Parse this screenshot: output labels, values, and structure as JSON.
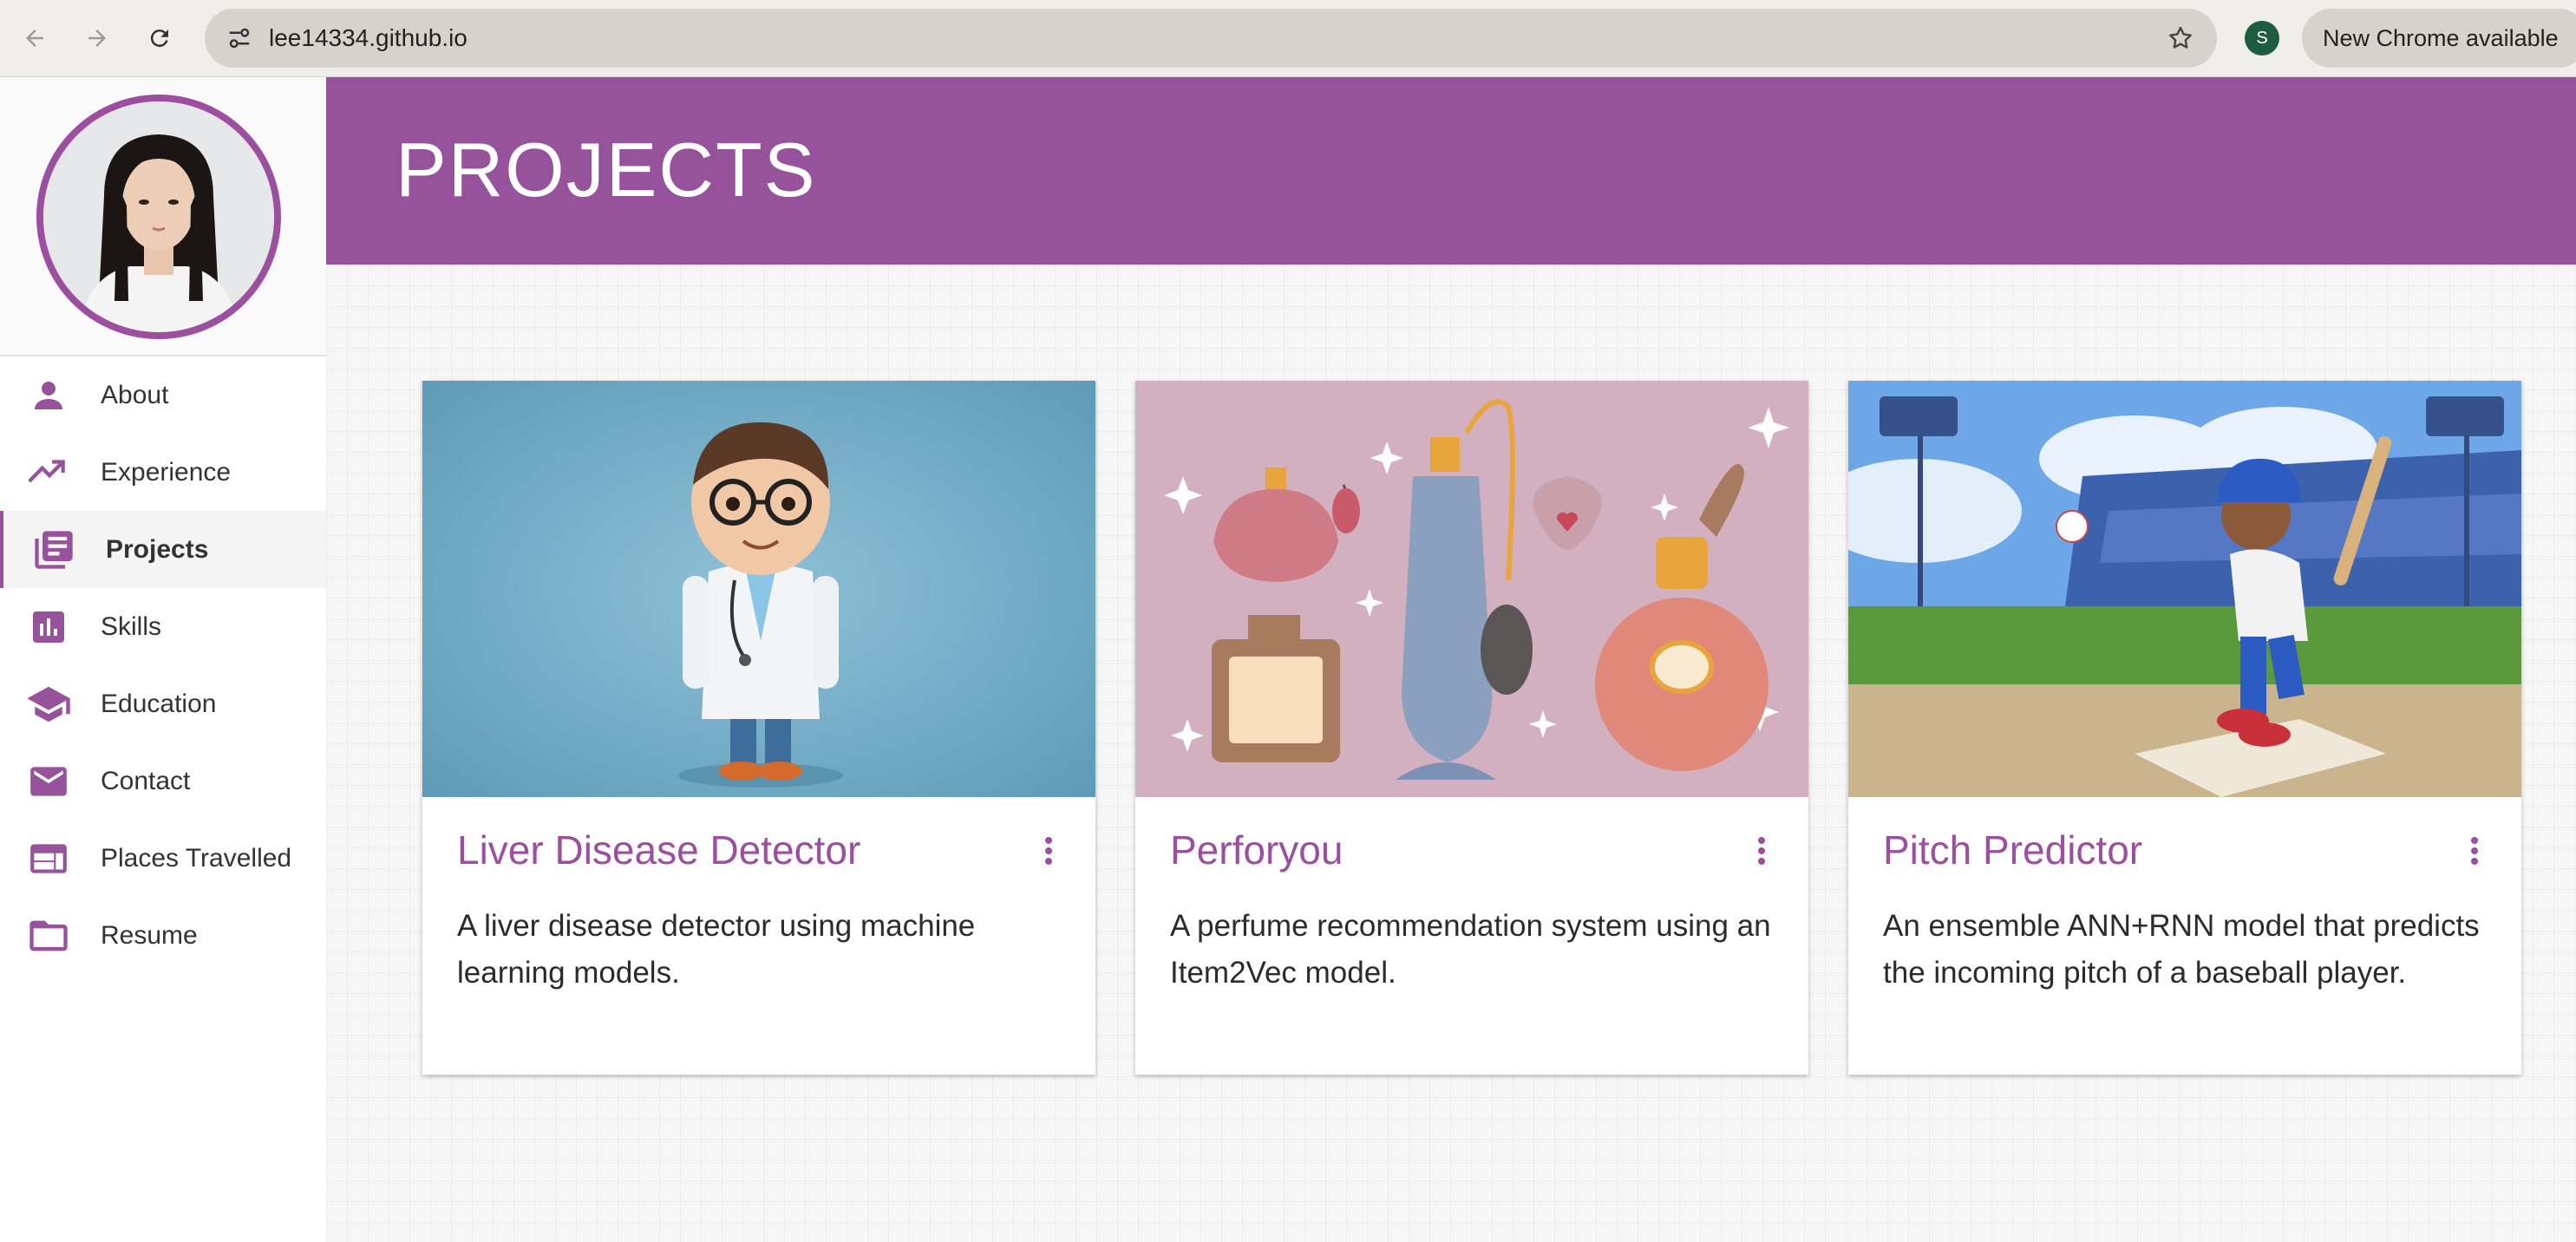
{
  "browser": {
    "url": "lee14334.github.io",
    "profile_initial": "S",
    "update_label": "New Chrome available"
  },
  "sidebar": {
    "items": [
      {
        "label": "About",
        "icon": "person-icon"
      },
      {
        "label": "Experience",
        "icon": "trending-up-icon"
      },
      {
        "label": "Projects",
        "icon": "library-books-icon",
        "active": true
      },
      {
        "label": "Skills",
        "icon": "bar-chart-icon"
      },
      {
        "label": "Education",
        "icon": "school-icon"
      },
      {
        "label": "Contact",
        "icon": "mail-icon"
      },
      {
        "label": "Places Travelled",
        "icon": "web-layout-icon"
      },
      {
        "label": "Resume",
        "icon": "folder-icon"
      }
    ]
  },
  "header": {
    "title": "PROJECTS"
  },
  "projects": [
    {
      "title": "Liver Disease Detector",
      "description": "A liver disease detector using machine learning models.",
      "image": "cartoon-doctor"
    },
    {
      "title": "Perforyou",
      "description": "A perfume recommendation system using an Item2Vec model.",
      "image": "perfume-bottles"
    },
    {
      "title": "Pitch Predictor",
      "description": "An ensemble ANN+RNN model that predicts the incoming pitch of a baseball player.",
      "image": "cartoon-batter"
    }
  ],
  "colors": {
    "accent": "#97529c",
    "title_text": "#9c4f9e"
  }
}
